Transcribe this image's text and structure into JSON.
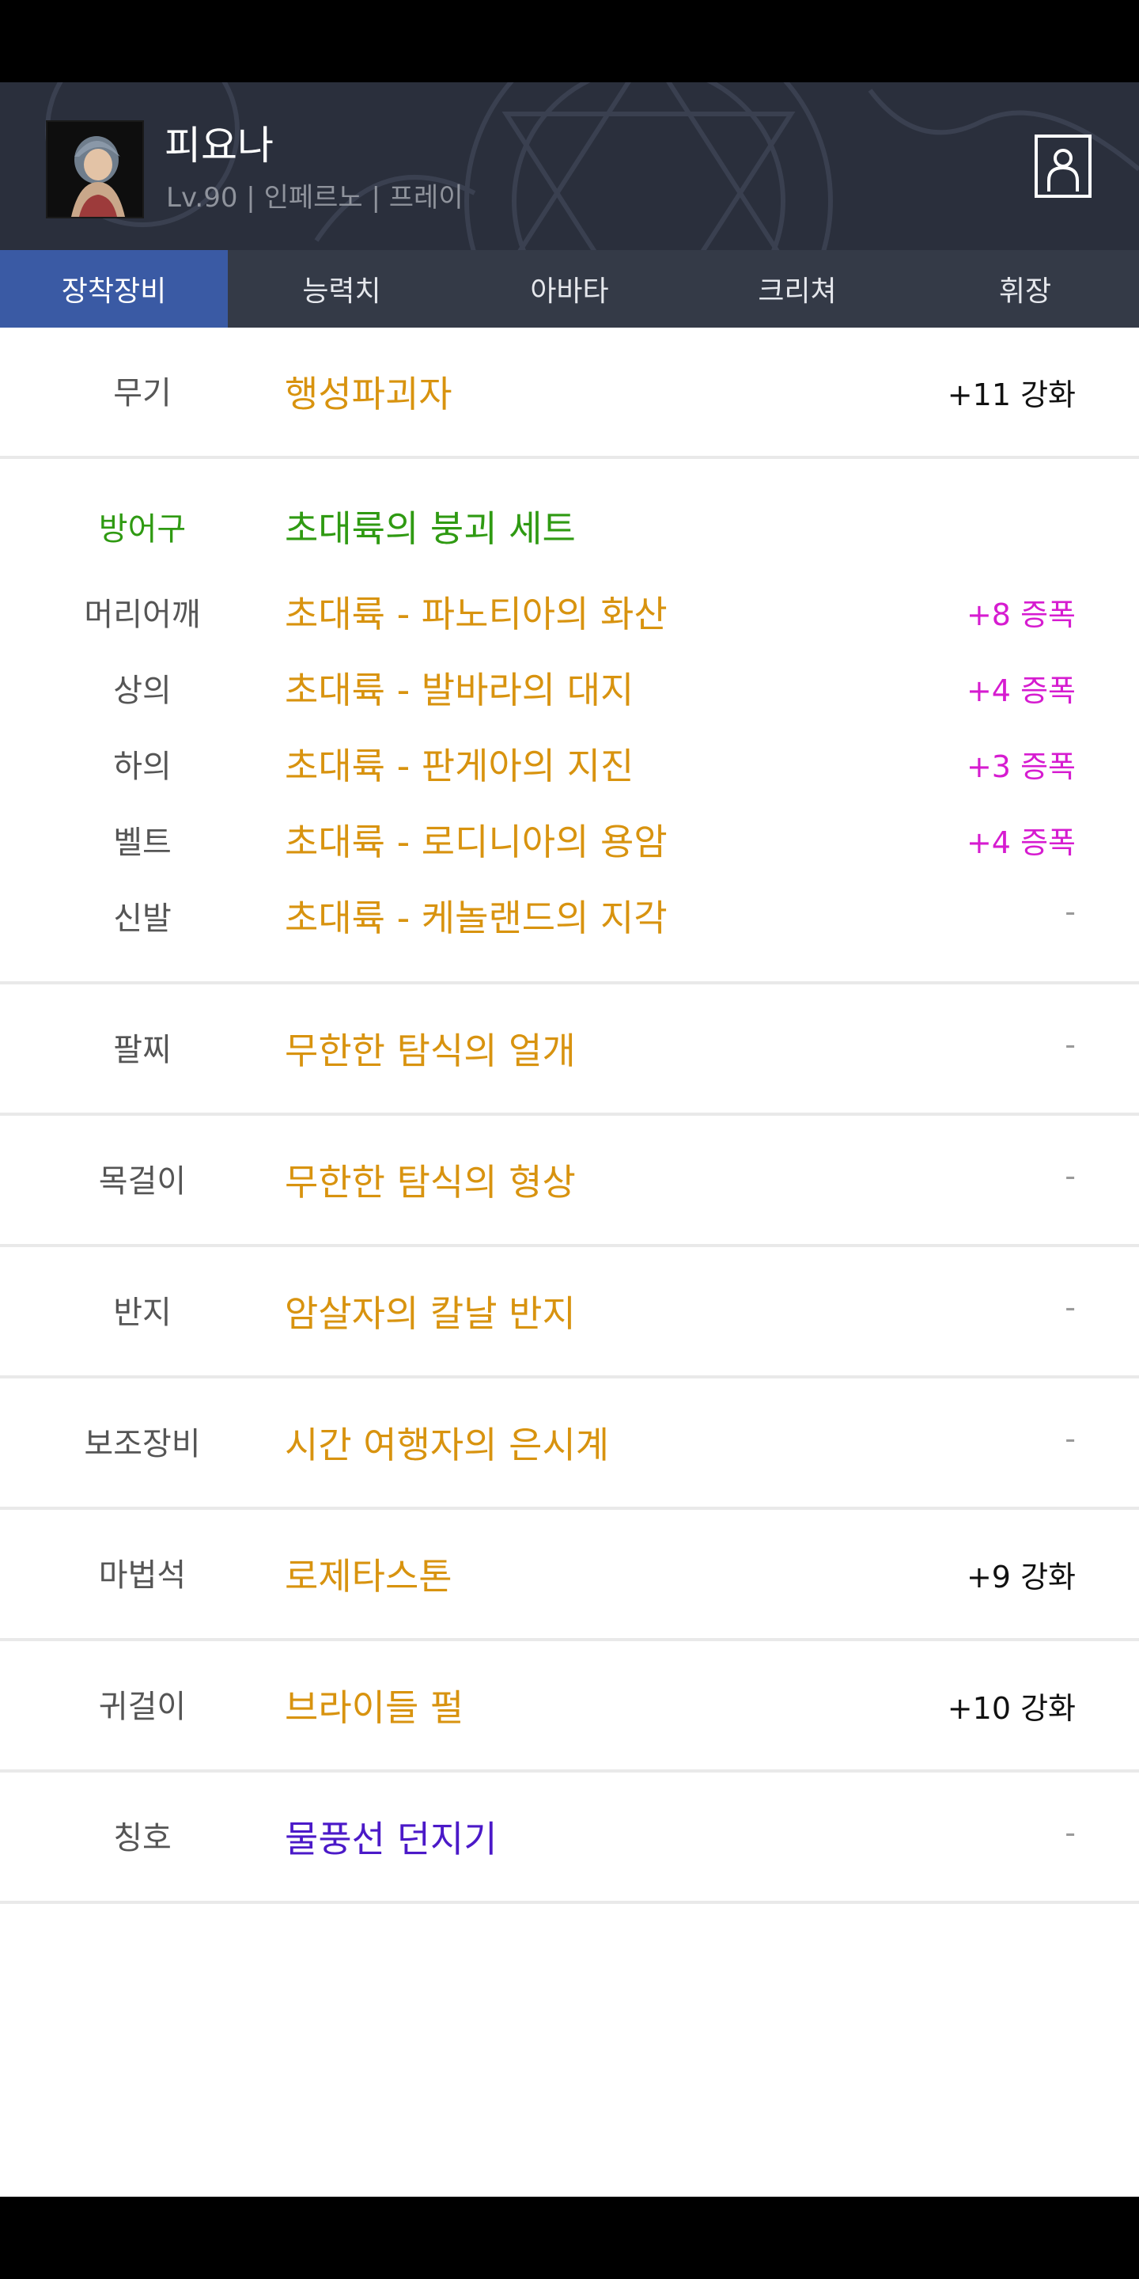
{
  "character": {
    "name": "피요나",
    "info": "Lv.90 | 인페르노 | 프레이"
  },
  "icons": {
    "profile": "person-frame-icon",
    "avatar": "character-portrait"
  },
  "tabs": [
    {
      "label": "장착장비",
      "active": true
    },
    {
      "label": "능력치",
      "active": false
    },
    {
      "label": "아바타",
      "active": false
    },
    {
      "label": "크리쳐",
      "active": false
    },
    {
      "label": "휘장",
      "active": false
    }
  ],
  "colors": {
    "item_rare": "#d8930f",
    "set_green": "#2f9a12",
    "amplify_magenta": "#d61cd0",
    "title_purple": "#4b19c8",
    "tab_active": "#3a5aa4"
  },
  "equipment": {
    "weapon": {
      "slot": "무기",
      "name": "행성파괴자",
      "value": "+11 강화"
    },
    "armor": {
      "slot": "방어구",
      "set_name": "초대륙의 붕괴 세트",
      "pieces": [
        {
          "slot": "머리어깨",
          "name": "초대륙 - 파노티아의 화산",
          "value": "+8 증폭"
        },
        {
          "slot": "상의",
          "name": "초대륙 - 발바라의 대지",
          "value": "+4 증폭"
        },
        {
          "slot": "하의",
          "name": "초대륙 - 판게아의 지진",
          "value": "+3 증폭"
        },
        {
          "slot": "벨트",
          "name": "초대륙 - 로디니아의 용암",
          "value": "+4 증폭"
        },
        {
          "slot": "신발",
          "name": "초대륙 - 케놀랜드의 지각",
          "value": "-"
        }
      ]
    },
    "others": [
      {
        "slot": "팔찌",
        "name": "무한한 탐식의 얼개",
        "value": "-"
      },
      {
        "slot": "목걸이",
        "name": "무한한 탐식의 형상",
        "value": "-"
      },
      {
        "slot": "반지",
        "name": "암살자의 칼날 반지",
        "value": "-"
      },
      {
        "slot": "보조장비",
        "name": "시간 여행자의 은시계",
        "value": "-"
      },
      {
        "slot": "마법석",
        "name": "로제타스톤",
        "value": "+9 강화"
      },
      {
        "slot": "귀걸이",
        "name": "브라이들 펄",
        "value": "+10 강화"
      },
      {
        "slot": "칭호",
        "name": "물풍선 던지기",
        "value": "-"
      }
    ]
  }
}
